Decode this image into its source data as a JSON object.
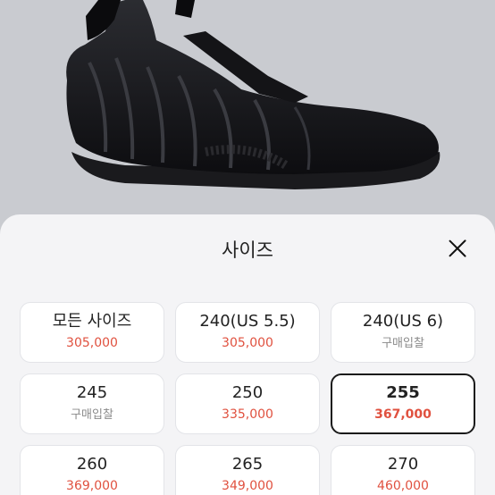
{
  "colors": {
    "price": "#e0513f",
    "secondary": "#8a8a8a",
    "selected_border": "#1a1a1a"
  },
  "product": {
    "image_icon": "sneaker-image"
  },
  "sheet": {
    "title": "사이즈",
    "close_icon": "close-icon"
  },
  "sizes": [
    {
      "label": "모든 사이즈",
      "sub": "305,000",
      "sub_type": "price"
    },
    {
      "label": "240(US 5.5)",
      "sub": "305,000",
      "sub_type": "price"
    },
    {
      "label": "240(US 6)",
      "sub": "구매입찰",
      "sub_type": "bid"
    },
    {
      "label": "245",
      "sub": "구매입찰",
      "sub_type": "bid"
    },
    {
      "label": "250",
      "sub": "335,000",
      "sub_type": "price"
    },
    {
      "label": "255",
      "sub": "367,000",
      "sub_type": "price",
      "selected": true
    },
    {
      "label": "260",
      "sub": "369,000",
      "sub_type": "price"
    },
    {
      "label": "265",
      "sub": "349,000",
      "sub_type": "price"
    },
    {
      "label": "270",
      "sub": "460,000",
      "sub_type": "price"
    }
  ]
}
